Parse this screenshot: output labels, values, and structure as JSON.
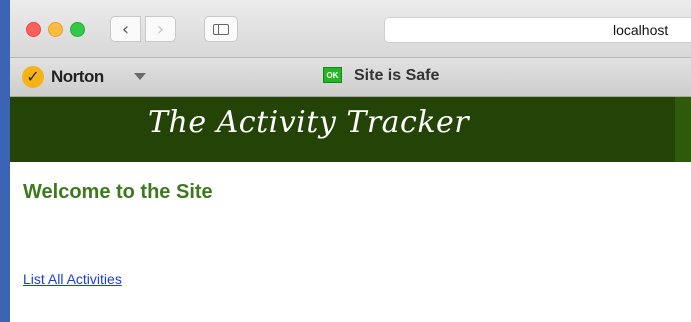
{
  "browser": {
    "nav": {
      "back_glyph": "‹",
      "forward_glyph": "›"
    },
    "address": "localhost"
  },
  "norton": {
    "name": "Norton",
    "safe_badge": "OK",
    "safe_text": "Site is Safe"
  },
  "page": {
    "banner_title": "The Activity Tracker",
    "heading": "Welcome to the Site",
    "link_label": "List All Activities"
  },
  "colors": {
    "banner_bg": "#244407",
    "heading": "#3d7a1d",
    "link": "#1a3fd6",
    "safe_badge": "#23b523",
    "norton_logo": "#f6b318"
  },
  "icons": {
    "close": "close-traffic-light-icon",
    "minimize": "minimize-traffic-light-icon",
    "maximize": "maximize-traffic-light-icon",
    "sidebar": "sidebar-icon",
    "norton_logo": "norton-check-icon",
    "norton_menu": "chevron-down-icon",
    "safe": "ok-badge-icon"
  }
}
